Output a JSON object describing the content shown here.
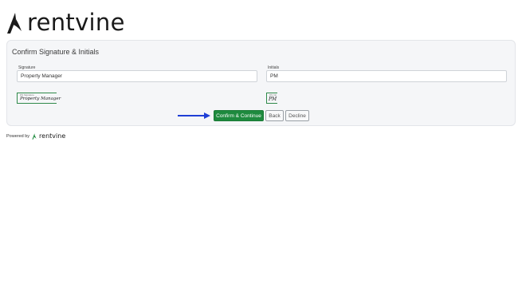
{
  "brand": {
    "name": "rentvine",
    "accent_color": "#1e8a3e",
    "logo_icon": "rentvine-leaf-icon"
  },
  "card": {
    "title": "Confirm Signature & Initials"
  },
  "signature": {
    "label": "Signature",
    "value": "Property Manager",
    "preview_caption": "DS Signature",
    "preview_text": "Property Manager"
  },
  "initials": {
    "label": "Initials",
    "value": "PM",
    "preview_caption": "DS Init",
    "preview_text": "PM"
  },
  "actions": {
    "confirm_label": "Confirm & Continue",
    "back_label": "Back",
    "decline_label": "Decline",
    "pointer_icon": "right-arrow-icon"
  },
  "footer": {
    "powered_by": "Powered by",
    "brand_name": "rentvine"
  }
}
